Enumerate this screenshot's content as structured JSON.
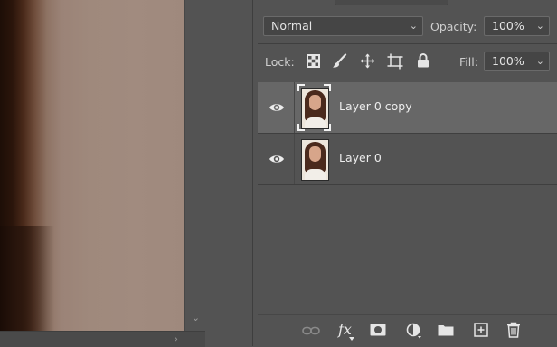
{
  "layers_panel": {
    "blend_mode": "Normal",
    "opacity_label": "Opacity:",
    "opacity_value": "100%",
    "lock_label": "Lock:",
    "fill_label": "Fill:",
    "fill_value": "100%",
    "layers": [
      {
        "name": "Layer 0 copy",
        "visible": true,
        "selected": true
      },
      {
        "name": "Layer 0",
        "visible": true,
        "selected": false
      }
    ],
    "bottom_icons": [
      "link-icon",
      "fx-icon",
      "mask-icon",
      "adjustment-icon",
      "folder-icon",
      "new-layer-icon",
      "trash-icon"
    ],
    "fx_text": "fx"
  },
  "colors": {
    "panel_bg": "#535353",
    "selected_row": "#676767",
    "field_bg": "#454545"
  }
}
